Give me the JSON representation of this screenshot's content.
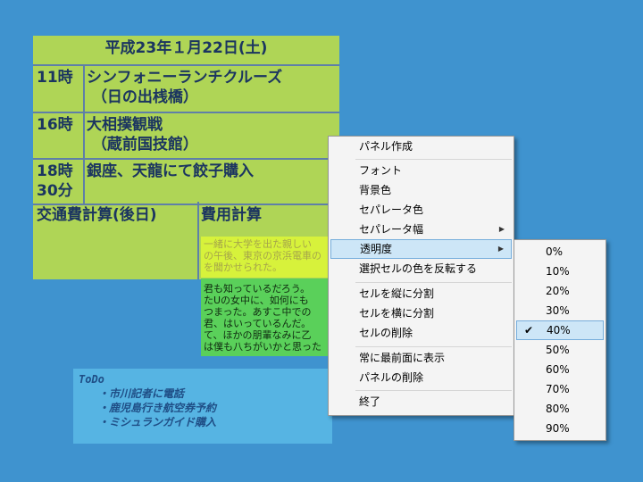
{
  "schedule": {
    "date": "平成23年１月22日(土)",
    "rows": [
      {
        "time": "11時",
        "desc": "シンフォニーランチクルーズ\n （日の出桟橋）"
      },
      {
        "time": "16時",
        "desc": "大相撲観戦\n （蔵前国技館）"
      },
      {
        "time": "18時\n30分",
        "desc": "銀座、天龍にて餃子購入"
      }
    ],
    "footer_left": "交通費計算(後日)",
    "footer_right": "費用計算"
  },
  "memo_yellow": "一緒に大学を出た親しい\nの午後、東京の京浜電車の\nを聞かせられた。",
  "memo_green": "君も知っているだろう。\nたUの女中に、如何にも\nつまった。あすこ中での\n君、はいっているんだ。\nて、ほかの朋輩なみに乙\nは僕も八ちがいかと思った",
  "todo": {
    "title": "ToDo",
    "items": [
      "・市川記者に電話",
      "・鹿児島行き航空券予約",
      "・ミシュランガイド購入"
    ]
  },
  "menu": {
    "items": [
      "パネル作成",
      "フォント",
      "背景色",
      "セパレータ色",
      "セパレータ幅",
      "透明度",
      "選択セルの色を反転する",
      "セルを縦に分割",
      "セルを横に分割",
      "セルの削除",
      "常に最前面に表示",
      "パネルの削除",
      "終了"
    ]
  },
  "submenu": {
    "items": [
      "0%",
      "10%",
      "20%",
      "30%",
      "40%",
      "50%",
      "60%",
      "70%",
      "80%",
      "90%"
    ],
    "selected": "40%",
    "check_mark": "✔"
  },
  "icons": {
    "submenu_arrow": "▶"
  }
}
